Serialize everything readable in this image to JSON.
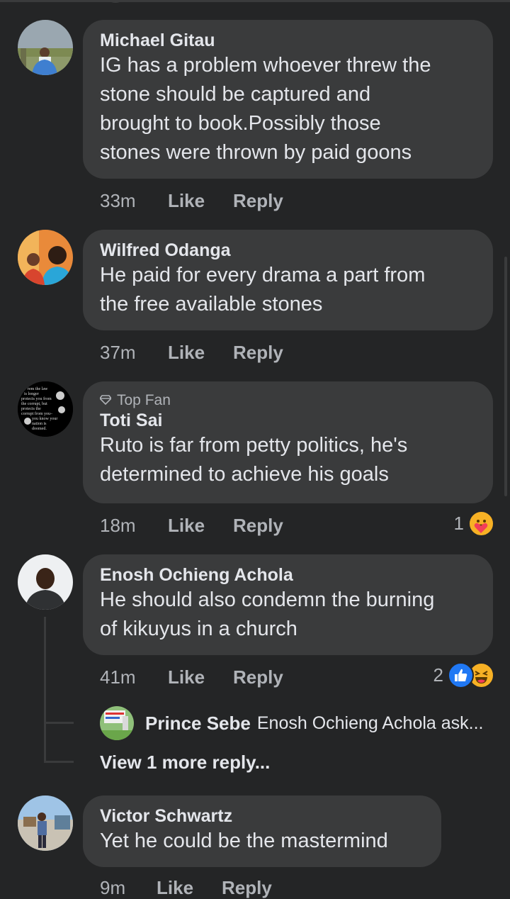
{
  "colors": {
    "background": "#242526",
    "bubble": "#3a3b3c",
    "text": "#e4e6eb",
    "muted": "#b0b3b8",
    "like_blue": "#2078f4",
    "haha_yellow": "#f7b125"
  },
  "comments": [
    {
      "author": "Michael Gitau",
      "lines": [
        "IG has a problem whoever threw the",
        "stone should be captured and",
        "brought to book.Possibly those",
        "stones were thrown by paid goons"
      ],
      "time": "33m",
      "like": "Like",
      "reply": "Reply"
    },
    {
      "author": "Wilfred Odanga",
      "lines": [
        "He paid for every drama a part from",
        "the free available stones"
      ],
      "time": "37m",
      "like": "Like",
      "reply": "Reply"
    },
    {
      "badge": "Top Fan",
      "author": "Toti Sai",
      "lines": [
        "Ruto is far from petty politics, he's",
        "determined to achieve his goals"
      ],
      "time": "18m",
      "like": "Like",
      "reply": "Reply",
      "reaction_count": "1",
      "reactions": [
        "care-icon"
      ]
    },
    {
      "author": "Enosh Ochieng Achola",
      "lines": [
        "He should also condemn the burning",
        "of kikuyus in a church"
      ],
      "time": "41m",
      "like": "Like",
      "reply": "Reply",
      "reaction_count": "2",
      "reactions": [
        "like-icon",
        "haha-icon"
      ],
      "reply_preview": {
        "author": "Prince Sebe",
        "text": "Enosh Ochieng Achola ask..."
      },
      "more_replies": "View 1 more reply..."
    },
    {
      "author": "Victor Schwartz",
      "lines": [
        "Yet he could be the mastermind"
      ],
      "time": "9m",
      "like": "Like",
      "reply": "Reply"
    }
  ],
  "avatar_quote": [
    "rem the law",
    "is longer",
    "protects you from",
    "the corrupt, but",
    "protects the",
    "corrupt from you–",
    "you know your",
    "nation is",
    "doomed."
  ]
}
